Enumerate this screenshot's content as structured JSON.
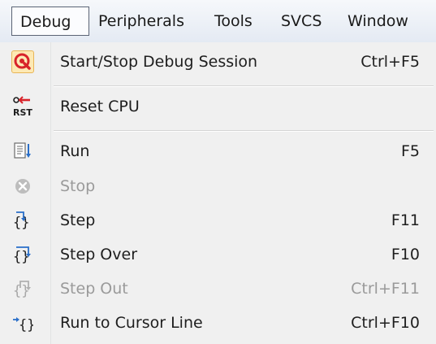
{
  "menubar": {
    "items": [
      {
        "label": "Debug"
      },
      {
        "label": "Peripherals"
      },
      {
        "label": "Tools"
      },
      {
        "label": "SVCS"
      },
      {
        "label": "Window"
      }
    ]
  },
  "menu": {
    "start_stop": {
      "label": "Start/Stop Debug Session",
      "shortcut": "Ctrl+F5",
      "icon": "debug-session-icon"
    },
    "reset": {
      "label": "Reset CPU",
      "icon": "reset-cpu-icon",
      "icon_text": "RST"
    },
    "run": {
      "label": "Run",
      "shortcut": "F5",
      "icon": "run-icon"
    },
    "stop": {
      "label": "Stop",
      "icon": "stop-icon"
    },
    "step": {
      "label": "Step",
      "shortcut": "F11",
      "icon": "step-into-icon"
    },
    "step_over": {
      "label": "Step Over",
      "shortcut": "F10",
      "icon": "step-over-icon"
    },
    "step_out": {
      "label": "Step Out",
      "shortcut": "Ctrl+F11",
      "icon": "step-out-icon"
    },
    "run_to_cursor": {
      "label": "Run to Cursor Line",
      "shortcut": "Ctrl+F10",
      "icon": "run-to-cursor-icon"
    }
  },
  "colors": {
    "disabled_text": "#9a9a9a",
    "icon_blue": "#2a6fc9",
    "icon_red": "#d8232a"
  }
}
